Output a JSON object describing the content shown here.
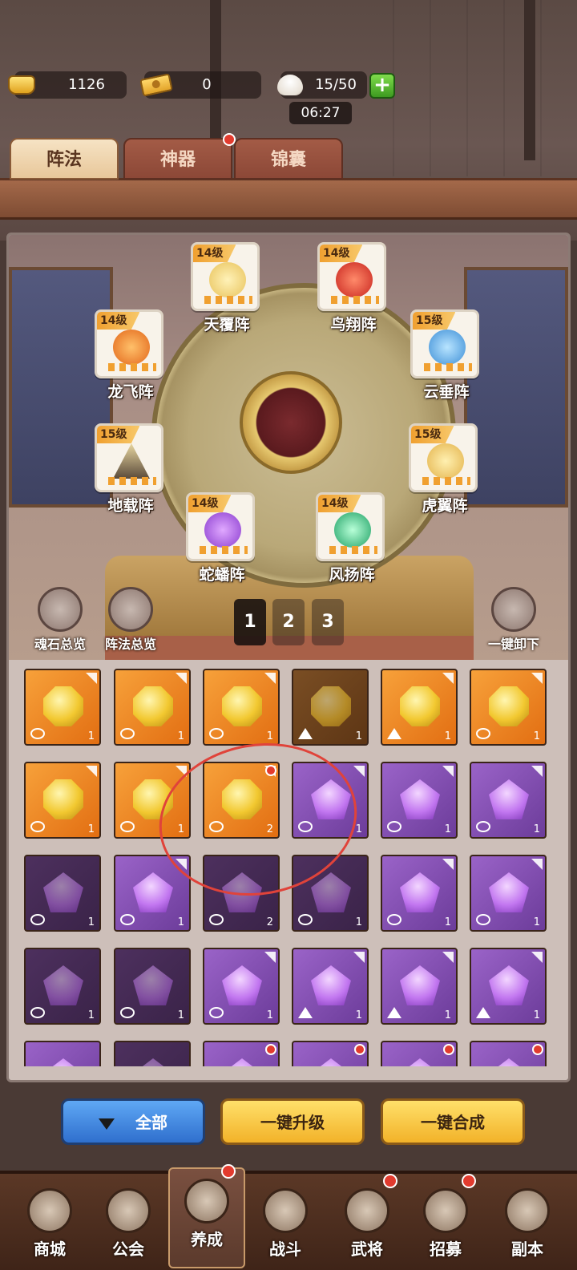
{
  "resources": {
    "gold": "1126",
    "ticket": "0",
    "stamina": "15/50",
    "timer": "06:27"
  },
  "tabs": [
    {
      "label": "阵法"
    },
    {
      "label": "神器"
    },
    {
      "label": "锦囊"
    }
  ],
  "formations": [
    {
      "level": "14级",
      "name": "天覆阵"
    },
    {
      "level": "14级",
      "name": "鸟翔阵"
    },
    {
      "level": "14级",
      "name": "龙飞阵"
    },
    {
      "level": "15级",
      "name": "云垂阵"
    },
    {
      "level": "15级",
      "name": "地载阵"
    },
    {
      "level": "15级",
      "name": "虎翼阵"
    },
    {
      "level": "14级",
      "name": "蛇蟠阵"
    },
    {
      "level": "14级",
      "name": "风扬阵"
    }
  ],
  "side_buttons": {
    "soul_overview": "魂石总览",
    "formation_overview": "阵法总览",
    "unload_all": "一键卸下"
  },
  "pages": [
    "1",
    "2",
    "3"
  ],
  "gems": [
    {
      "color": "orange",
      "count": "1"
    },
    {
      "color": "orange",
      "count": "1"
    },
    {
      "color": "orange",
      "count": "1"
    },
    {
      "color": "orange-dim",
      "count": "1"
    },
    {
      "color": "orange",
      "count": "1"
    },
    {
      "color": "orange",
      "count": "1"
    },
    {
      "color": "orange",
      "count": "1"
    },
    {
      "color": "orange",
      "count": "1"
    },
    {
      "color": "orange",
      "count": "2"
    },
    {
      "color": "purple",
      "count": "1"
    },
    {
      "color": "purple",
      "count": "1"
    },
    {
      "color": "purple",
      "count": "1"
    },
    {
      "color": "purple-dim",
      "count": "1"
    },
    {
      "color": "purple",
      "count": "1"
    },
    {
      "color": "purple-dim",
      "count": "2"
    },
    {
      "color": "purple-dim",
      "count": "1"
    },
    {
      "color": "purple",
      "count": "1"
    },
    {
      "color": "purple",
      "count": "1"
    },
    {
      "color": "purple-dim",
      "count": "1"
    },
    {
      "color": "purple-dim",
      "count": "1"
    },
    {
      "color": "purple",
      "count": "1"
    },
    {
      "color": "purple",
      "count": "1"
    },
    {
      "color": "purple",
      "count": "1"
    },
    {
      "color": "purple",
      "count": "1"
    }
  ],
  "actions": {
    "filter": "全部",
    "upgrade": "一键升级",
    "combine": "一键合成"
  },
  "nav": [
    {
      "label": "商城"
    },
    {
      "label": "公会"
    },
    {
      "label": "养成"
    },
    {
      "label": "战斗"
    },
    {
      "label": "武将"
    },
    {
      "label": "招募"
    },
    {
      "label": "副本"
    }
  ],
  "colors": {
    "badge_red": "#e23b2e",
    "accent_orange": "#f0a030",
    "accent_purple": "#9a63c8",
    "button_blue": "#2f6fcd",
    "button_yellow": "#f2b229"
  }
}
